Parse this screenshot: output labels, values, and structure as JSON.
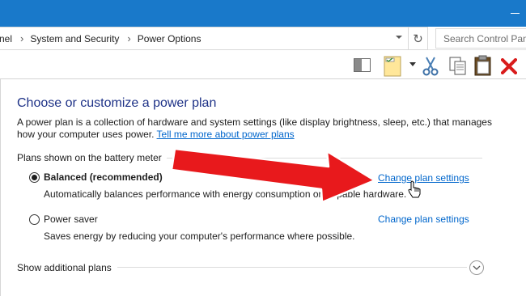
{
  "address": {
    "crumbs": [
      "nel",
      "System and Security",
      "Power Options"
    ],
    "search_placeholder": "Search Control Panel"
  },
  "toolbar": {
    "icons": [
      "preview-pane-icon",
      "notes-icon",
      "cut-icon",
      "copy-icon",
      "paste-icon",
      "delete-icon"
    ]
  },
  "page": {
    "title": "Choose or customize a power plan",
    "description": "A power plan is a collection of hardware and system settings (like display brightness, sleep, etc.) that manages how your computer uses power.",
    "learn_more_link": "Tell me more about power plans",
    "group_label": "Plans shown on the battery meter",
    "plans": [
      {
        "name": "Balanced (recommended)",
        "description": "Automatically balances performance with energy consumption on capable hardware.",
        "link": "Change plan settings",
        "selected": true
      },
      {
        "name": "Power saver",
        "description": "Saves energy by reducing your computer's performance where possible.",
        "link": "Change plan settings",
        "selected": false
      }
    ],
    "show_more": "Show additional plans"
  },
  "colors": {
    "title_bar": "#1979ca",
    "heading": "#1e3287",
    "link": "#0066cc",
    "annotation_arrow": "#e8191c"
  }
}
